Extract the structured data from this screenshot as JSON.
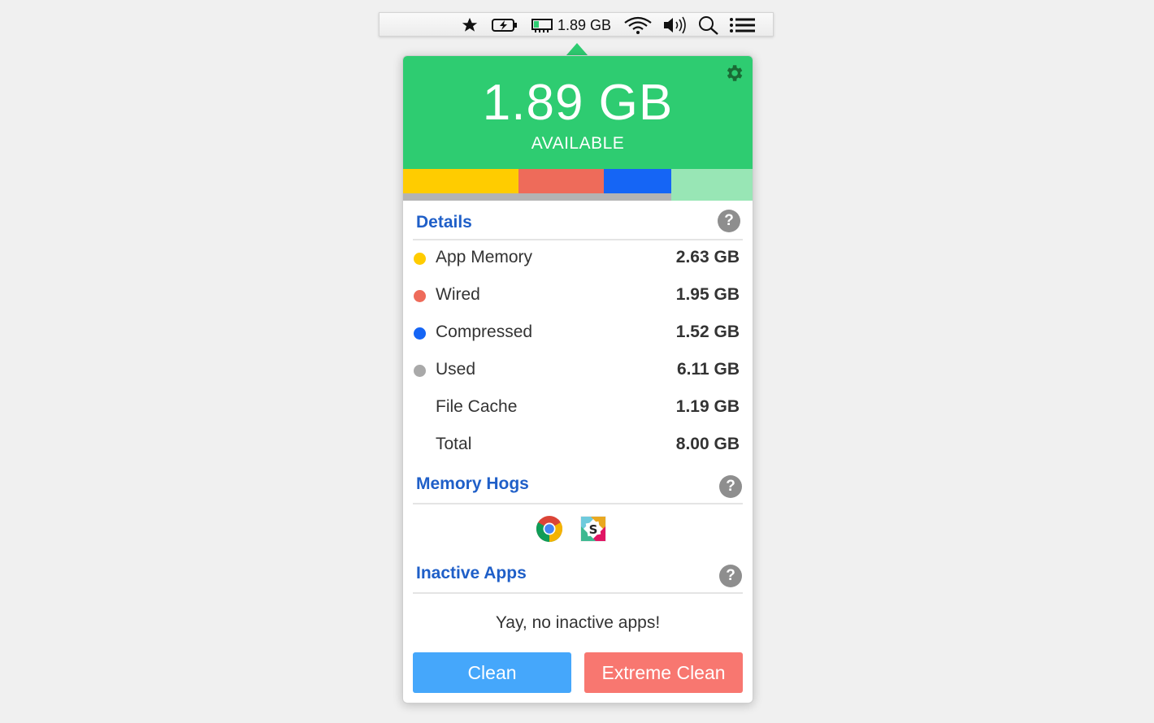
{
  "menubar": {
    "memory_label": "1.89 GB",
    "icons": [
      "star-icon",
      "battery-charging-icon",
      "ram-icon",
      "wifi-icon",
      "volume-icon",
      "search-icon",
      "notification-list-icon"
    ]
  },
  "hero": {
    "value": "1.89 GB",
    "label": "AVAILABLE",
    "color": "#2ecc71"
  },
  "usage_bar": [
    {
      "name": "App Memory",
      "color": "#ffcc00",
      "gb": 2.63
    },
    {
      "name": "Wired",
      "color": "#ee6b5a",
      "gb": 1.95
    },
    {
      "name": "Compressed",
      "color": "#1565f5",
      "gb": 1.52
    },
    {
      "name": "Available",
      "color": "#98e6b5",
      "gb": 1.89
    }
  ],
  "details": {
    "title": "Details",
    "help": "?",
    "rows": [
      {
        "label": "App Memory",
        "value": "2.63 GB",
        "color": "#ffcc00"
      },
      {
        "label": "Wired",
        "value": "1.95 GB",
        "color": "#ee6b5a"
      },
      {
        "label": "Compressed",
        "value": "1.52 GB",
        "color": "#1565f5"
      },
      {
        "label": "Used",
        "value": "6.11 GB",
        "color": "#a9a9a9"
      },
      {
        "label": "File Cache",
        "value": "1.19 GB"
      },
      {
        "label": "Total",
        "value": "8.00 GB"
      }
    ]
  },
  "memory_hogs": {
    "title": "Memory Hogs",
    "help": "?",
    "apps": [
      "chrome-icon",
      "slack-icon"
    ]
  },
  "inactive_apps": {
    "title": "Inactive Apps",
    "help": "?",
    "empty_text": "Yay, no inactive apps!"
  },
  "buttons": {
    "clean": "Clean",
    "clean_color": "#45a7fb",
    "extreme_clean": "Extreme Clean",
    "extreme_color": "#f87770"
  }
}
